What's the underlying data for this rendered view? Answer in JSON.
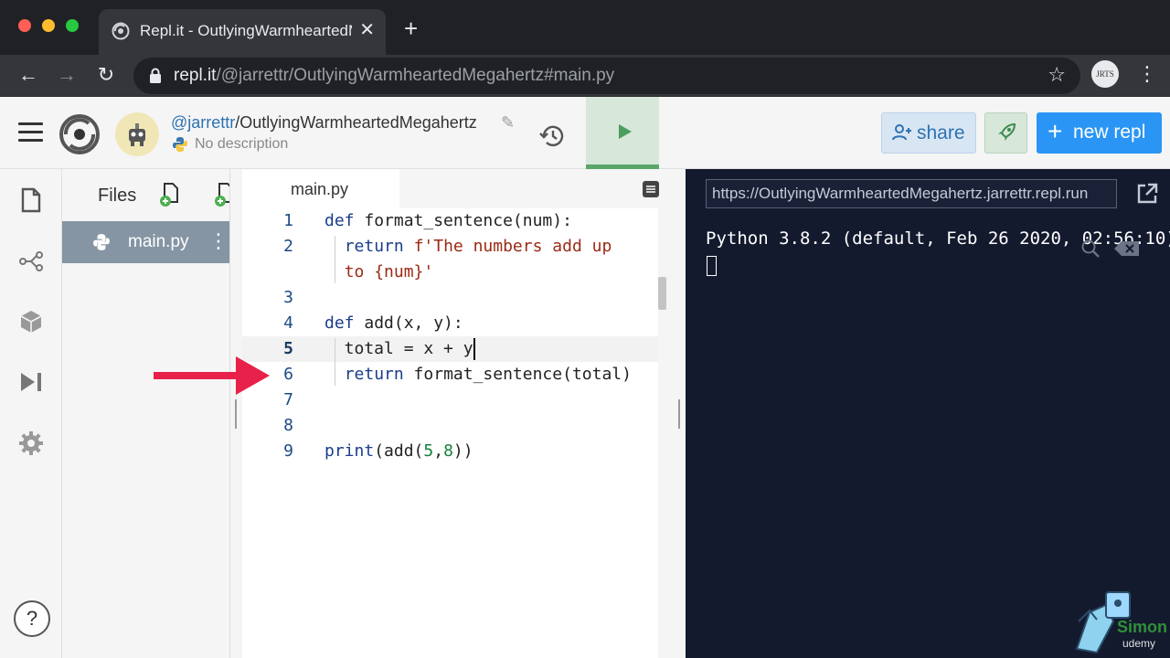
{
  "browser": {
    "tab_title": "Repl.it - OutlyingWarmheartedMegahertz",
    "tab_close": "✕",
    "new_tab": "+",
    "url_host": "repl.it",
    "url_path": "/@jarrettr/OutlyingWarmheartedMegahertz#main.py",
    "profile_initials": "JRTS"
  },
  "header": {
    "owner": "@jarrettr",
    "separator": "/",
    "project_name": "OutlyingWarmheartedMegahertz",
    "description": "No description",
    "share_label": "share",
    "new_repl_plus": "+",
    "new_repl_label": "new repl"
  },
  "files": {
    "title": "Files",
    "items": [
      {
        "name": "main.py"
      }
    ]
  },
  "editor": {
    "active_tab": "main.py",
    "current_line": 5,
    "lines": [
      {
        "n": "1",
        "tokens": [
          [
            "kw",
            "def"
          ],
          [
            "p",
            " format_sentence(num):"
          ]
        ]
      },
      {
        "n": "2",
        "tokens": [
          [
            "p",
            "  "
          ],
          [
            "kw",
            "return"
          ],
          [
            "p",
            " "
          ],
          [
            "str",
            "f'The numbers add up"
          ]
        ]
      },
      {
        "n": "",
        "tokens": [
          [
            "p",
            "  "
          ],
          [
            "str",
            "to {num}'"
          ]
        ]
      },
      {
        "n": "3",
        "tokens": []
      },
      {
        "n": "4",
        "tokens": [
          [
            "kw",
            "def"
          ],
          [
            "p",
            " add(x, y):"
          ]
        ]
      },
      {
        "n": "5",
        "tokens": [
          [
            "p",
            "  total = x + y"
          ]
        ]
      },
      {
        "n": "6",
        "tokens": [
          [
            "p",
            "  "
          ],
          [
            "kw",
            "return"
          ],
          [
            "p",
            " format_sentence(total)"
          ]
        ]
      },
      {
        "n": "7",
        "tokens": []
      },
      {
        "n": "8",
        "tokens": []
      },
      {
        "n": "9",
        "tokens": [
          [
            "kw",
            "print"
          ],
          [
            "p",
            "(add("
          ],
          [
            "num",
            "5"
          ],
          [
            "p",
            ","
          ],
          [
            "num",
            "8"
          ],
          [
            "p",
            "))"
          ]
        ]
      }
    ]
  },
  "console": {
    "url": "https://OutlyingWarmheartedMegahertz.jarrettr.repl.run",
    "output": "Python 3.8.2 (default, Feb 26 2020, 02:56:10)"
  },
  "help_label": "?",
  "watermark": {
    "brand": "Simon",
    "platform": "udemy"
  },
  "colors": {
    "accent_blue": "#2a95f4",
    "run_green": "#4b9e5d",
    "console_bg": "#141a2e",
    "annotation_arrow": "#e8214a"
  }
}
